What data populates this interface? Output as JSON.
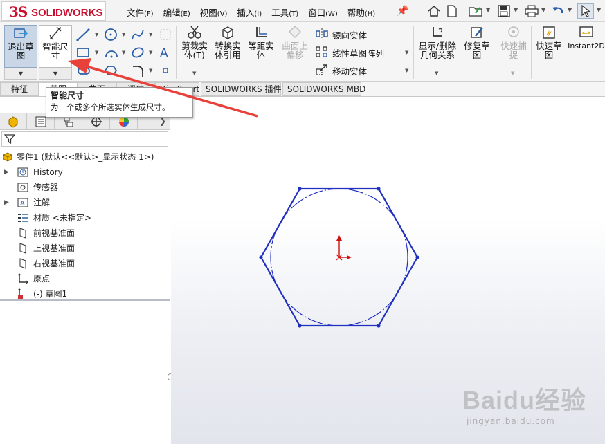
{
  "app": {
    "logo_ds": "3S",
    "logo_name": "SOLIDWORKS"
  },
  "menu": [
    {
      "label": "文件",
      "hotkey": "(F)"
    },
    {
      "label": "编辑",
      "hotkey": "(E)"
    },
    {
      "label": "视图",
      "hotkey": "(V)"
    },
    {
      "label": "插入",
      "hotkey": "(I)"
    },
    {
      "label": "工具",
      "hotkey": "(T)"
    },
    {
      "label": "窗口",
      "hotkey": "(W)"
    },
    {
      "label": "帮助",
      "hotkey": "(H)"
    }
  ],
  "ribbon": {
    "exit_sketch_l1": "退出草",
    "exit_sketch_l2": "图",
    "smart_dim_l1": "智能尺",
    "smart_dim_l2": "寸",
    "trim_l1": "剪裁实",
    "trim_l2": "体(T)",
    "convert_l1": "转换实",
    "convert_l2": "体引用",
    "offset_l1": "等距实",
    "offset_l2": "体",
    "surface_offset_l1": "曲面上",
    "surface_offset_l2": "偏移",
    "mirror": "镜向实体",
    "linear_pattern": "线性草图阵列",
    "move": "移动实体",
    "show_relations_l1": "显示/删除",
    "show_relations_l2": "几何关系",
    "repair_l1": "修复草",
    "repair_l2": "图",
    "quick_snap_l1": "快速捕",
    "quick_snap_l2": "捉",
    "rapid_sketch_l1": "快速草",
    "rapid_sketch_l2": "图",
    "instant2d": "Instant2D"
  },
  "tabs": [
    "特征",
    "草图",
    "曲面",
    "评估",
    "DimXpert",
    "SOLIDWORKS 插件",
    "SOLIDWORKS MBD"
  ],
  "tooltip": {
    "title": "智能尺寸",
    "description": "为一个或多个所选实体生成尺寸。"
  },
  "tree": {
    "part": "零件1 (默认<<默认>_显示状态 1>)",
    "items": [
      {
        "label": "History",
        "expandable": true,
        "icon": "history-icon"
      },
      {
        "label": "传感器",
        "expandable": false,
        "icon": "sensor-icon"
      },
      {
        "label": "注解",
        "expandable": true,
        "icon": "annotation-icon"
      },
      {
        "label": "材质 <未指定>",
        "expandable": false,
        "icon": "material-icon"
      },
      {
        "label": "前视基准面",
        "expandable": false,
        "icon": "plane-icon"
      },
      {
        "label": "上视基准面",
        "expandable": false,
        "icon": "plane-icon"
      },
      {
        "label": "右视基准面",
        "expandable": false,
        "icon": "plane-icon"
      },
      {
        "label": "原点",
        "expandable": false,
        "icon": "origin-icon"
      },
      {
        "label": "(-) 草图1",
        "expandable": false,
        "icon": "sketch-icon"
      }
    ]
  },
  "watermark": {
    "main": "Baidu经验",
    "sub": "jingyan.baidu.com"
  },
  "colors": {
    "sketch": "#2030c0",
    "origin": "#d01010",
    "arrow": "#e8413a",
    "brand": "#c8102e"
  }
}
